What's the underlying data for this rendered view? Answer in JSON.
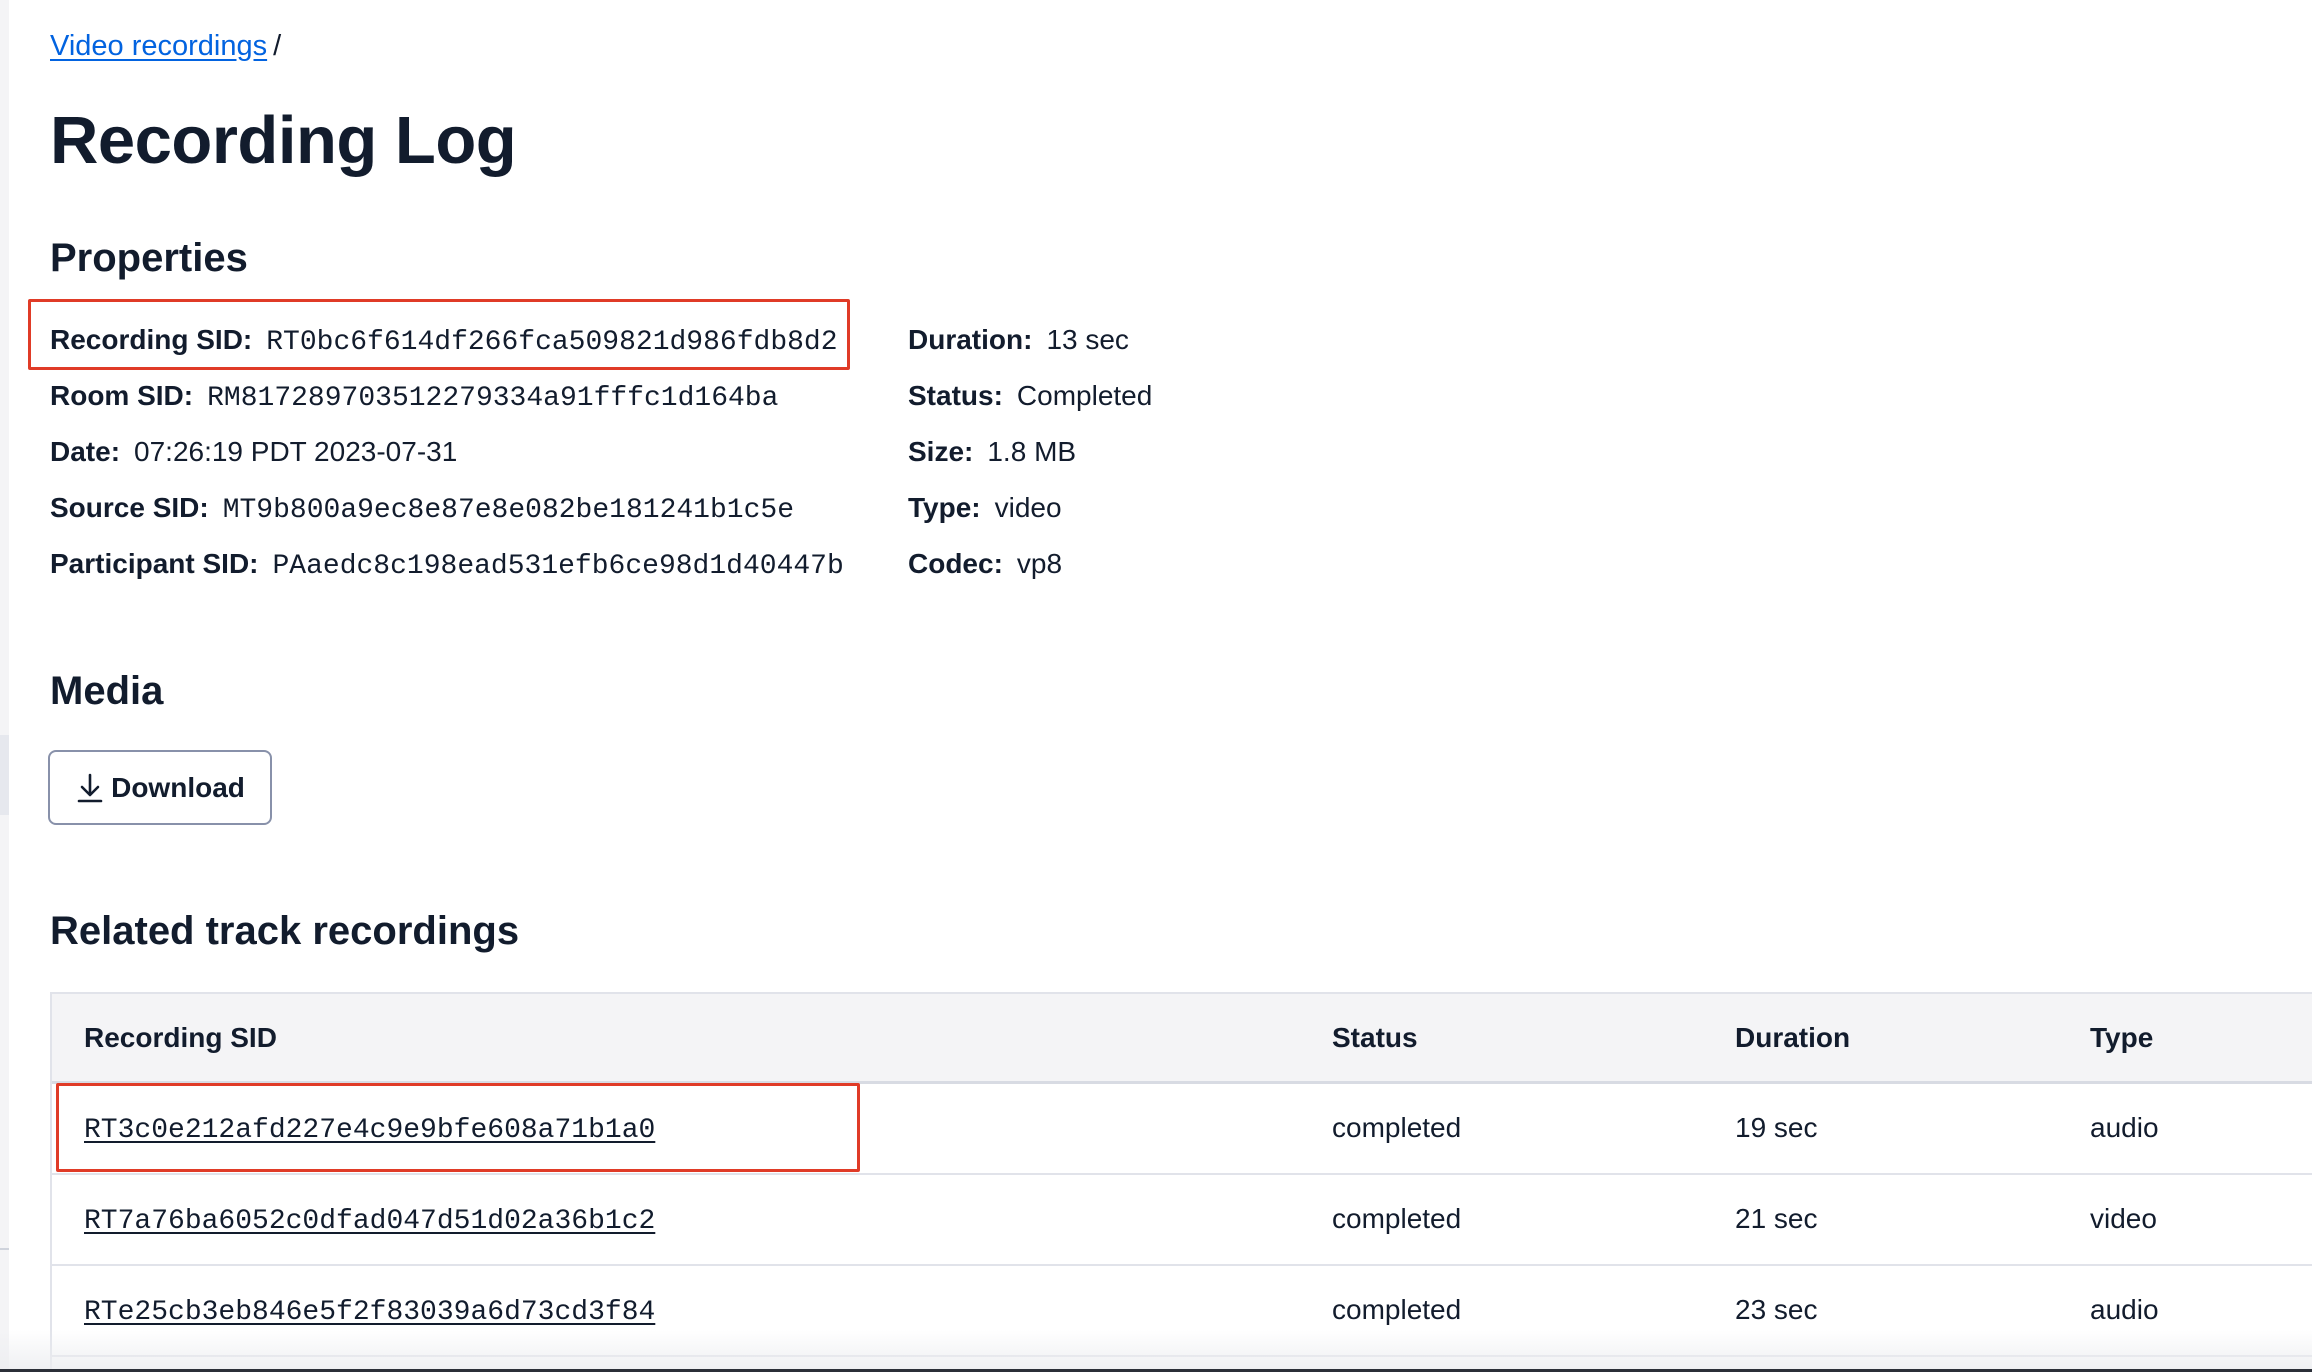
{
  "breadcrumb": {
    "link": "Video recordings",
    "separator": "/"
  },
  "page_title": "Recording Log",
  "properties": {
    "heading": "Properties",
    "left": [
      {
        "label": "Recording SID:",
        "value": "RT0bc6f614df266fca509821d986fdb8d2"
      },
      {
        "label": "Room SID:",
        "value": "RM817289703512279334a91fffc1d164ba"
      },
      {
        "label": "Date:",
        "value": "07:26:19 PDT 2023-07-31"
      },
      {
        "label": "Source SID:",
        "value": "MT9b800a9ec8e87e8e082be181241b1c5e"
      },
      {
        "label": "Participant SID:",
        "value": "PAaedc8c198ead531efb6ce98d1d40447b"
      }
    ],
    "right": [
      {
        "label": "Duration:",
        "value": "13 sec"
      },
      {
        "label": "Status:",
        "value": "Completed"
      },
      {
        "label": "Size:",
        "value": "1.8 MB"
      },
      {
        "label": "Type:",
        "value": "video"
      },
      {
        "label": "Codec:",
        "value": "vp8"
      }
    ]
  },
  "media": {
    "heading": "Media",
    "download_label": "Download",
    "download_icon": "download-icon"
  },
  "related": {
    "heading": "Related track recordings",
    "columns": [
      "Recording SID",
      "Status",
      "Duration",
      "Type"
    ],
    "rows": [
      {
        "sid": "RT3c0e212afd227e4c9e9bfe608a71b1a0",
        "status": "completed",
        "duration": "19 sec",
        "type": "audio"
      },
      {
        "sid": "RT7a76ba6052c0dfad047d51d02a36b1c2",
        "status": "completed",
        "duration": "21 sec",
        "type": "video"
      },
      {
        "sid": "RTe25cb3eb846e5f2f83039a6d73cd3f84",
        "status": "completed",
        "duration": "23 sec",
        "type": "audio"
      }
    ]
  },
  "colors": {
    "link": "#0263e0",
    "highlight_border": "#e03b27",
    "text": "#121c2d"
  }
}
